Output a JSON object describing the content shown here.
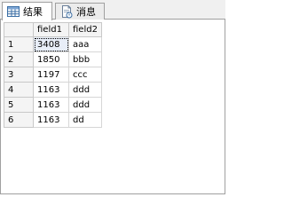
{
  "tabs": [
    {
      "label": "结果",
      "icon": "grid-icon",
      "active": true
    },
    {
      "label": "消息",
      "icon": "message-icon",
      "active": false
    }
  ],
  "grid": {
    "columns": [
      "field1",
      "field2"
    ],
    "rows": [
      {
        "num": "1",
        "field1": "3408",
        "field2": "aaa"
      },
      {
        "num": "2",
        "field1": "1850",
        "field2": "bbb"
      },
      {
        "num": "3",
        "field1": "1197",
        "field2": "ccc"
      },
      {
        "num": "4",
        "field1": "1163",
        "field2": "ddd"
      },
      {
        "num": "5",
        "field1": "1163",
        "field2": "ddd"
      },
      {
        "num": "6",
        "field1": "1163",
        "field2": "dd"
      }
    ]
  },
  "colors": {
    "tab_border": "#a0a0a0",
    "header_bg": "#f4f4f4",
    "grid_line": "#d6d6d6"
  }
}
